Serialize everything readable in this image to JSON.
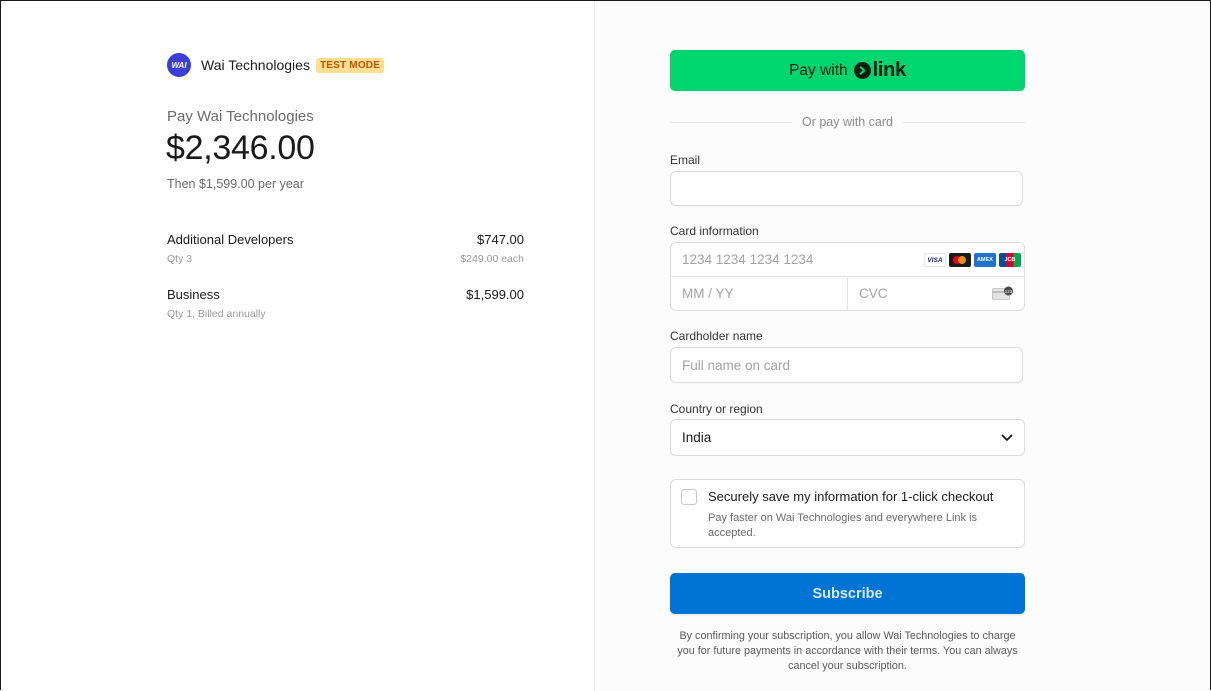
{
  "merchant": {
    "name": "Wai Technologies",
    "logo_text": "WAI",
    "test_badge": "TEST MODE",
    "pay_label": "Pay Wai Technologies",
    "amount": "$2,346.00",
    "recurring": "Then $1,599.00 per year"
  },
  "line_items": [
    {
      "name": "Additional Developers",
      "detail": "Qty 3",
      "price": "$747.00",
      "unit_price": "$249.00 each"
    },
    {
      "name": "Business",
      "detail": "Qty 1, Billed annually",
      "price": "$1,599.00",
      "unit_price": ""
    }
  ],
  "checkout": {
    "link_button": {
      "prefix": "Pay with",
      "brand": "link"
    },
    "divider": "Or pay with card",
    "email": {
      "label": "Email",
      "value": "",
      "placeholder": ""
    },
    "card": {
      "label": "Card information",
      "number_placeholder": "1234 1234 1234 1234",
      "expiry_placeholder": "MM / YY",
      "cvc_placeholder": "CVC",
      "brands": [
        "VISA",
        "mastercard",
        "AMEX",
        "JCB"
      ]
    },
    "cardholder": {
      "label": "Cardholder name",
      "placeholder": "Full name on card"
    },
    "country": {
      "label": "Country or region",
      "value": "India"
    },
    "save_info": {
      "title": "Securely save my information for 1-click checkout",
      "description": "Pay faster on Wai Technologies and everywhere Link is accepted.",
      "checked": false
    },
    "subscribe_label": "Subscribe",
    "terms": "By confirming your subscription, you allow Wai Technologies to charge you for future payments in accordance with their terms. You can always cancel your subscription."
  },
  "colors": {
    "link_green": "#00d66f",
    "subscribe_blue": "#0074d4",
    "test_badge_bg": "#ffde92",
    "logo_blue": "#3b3fd8"
  }
}
